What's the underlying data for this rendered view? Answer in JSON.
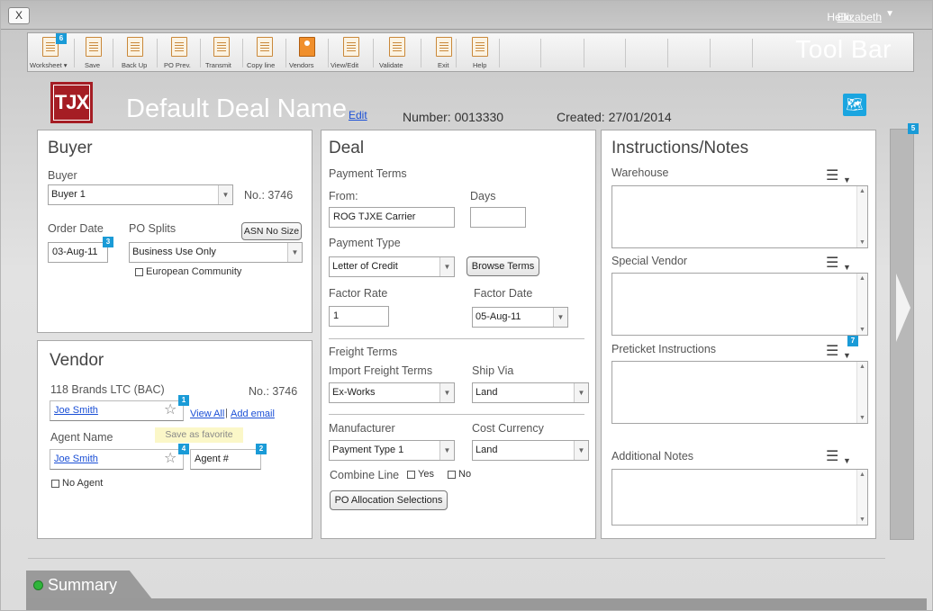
{
  "window": {
    "close_label": "X"
  },
  "user": {
    "greeting": "Hello,",
    "name": "Elizabeth"
  },
  "toolbar": {
    "title": "Tool Bar",
    "items": [
      {
        "label": "Worksheet ▾",
        "badge": "6"
      },
      {
        "label": "Save"
      },
      {
        "label": "Back Up"
      },
      {
        "label": "PO Prev."
      },
      {
        "label": "Transmit"
      },
      {
        "label": "Copy line"
      },
      {
        "label": "Vendors"
      },
      {
        "label": "View/Edit"
      },
      {
        "label": "Validate"
      },
      {
        "label": "Exit"
      },
      {
        "label": "Help"
      }
    ]
  },
  "header": {
    "logo_text": "TJX",
    "deal_name": "Default Deal Name",
    "edit_label": "Edit",
    "number": "Number: 0013330",
    "created": "Created: 27/01/2014"
  },
  "buyer": {
    "title": "Buyer",
    "buyer_label": "Buyer",
    "buyer_value": "Buyer 1",
    "number": "No.: 3746",
    "order_date_label": "Order Date",
    "order_date_value": "03-Aug-11",
    "order_date_badge": "3",
    "po_splits_label": "PO Splits",
    "asn_button": "ASN No Size",
    "po_splits_value": "Business Use Only",
    "european_label": "European Community"
  },
  "vendor": {
    "title": "Vendor",
    "vendor_name": "118 Brands LTC (BAC)",
    "number": "No.: 3746",
    "contact_value": "Joe Smith",
    "contact_badge": "1",
    "view_all": "View All",
    "add_email": "Add email",
    "agent_label": "Agent Name",
    "tooltip": "Save as favorite",
    "agent_value": "Joe Smith",
    "agent_badge": "4",
    "agent_num_placeholder": "Agent #",
    "agent_num_badge": "2",
    "no_agent_label": "No Agent"
  },
  "deal": {
    "title": "Deal",
    "payment_terms_label": "Payment Terms",
    "from_label": "From:",
    "from_value": "ROG TJXE Carrier",
    "days_label": "Days",
    "days_value": "",
    "payment_type_label": "Payment Type",
    "payment_type_value": "Letter of Credit",
    "browse_terms": "Browse Terms",
    "factor_rate_label": "Factor Rate",
    "factor_rate_value": "1",
    "factor_date_label": "Factor Date",
    "factor_date_value": "05-Aug-11",
    "freight_terms_label": "Freight Terms",
    "import_freight_label": "Import Freight Terms",
    "import_freight_value": "Ex-Works",
    "ship_via_label": "Ship Via",
    "ship_via_value": "Land",
    "manufacturer_label": "Manufacturer",
    "manufacturer_value": "Payment Type 1",
    "cost_currency_label": "Cost Currency",
    "cost_currency_value": "Land",
    "combine_line_label": "Combine Line",
    "yes_label": "Yes",
    "no_label": "No",
    "po_allocation": "PO Allocation Selections"
  },
  "notes": {
    "title": "Instructions/Notes",
    "warehouse_label": "Warehouse",
    "special_vendor_label": "Special Vendor",
    "preticket_label": "Preticket Instructions",
    "preticket_badge": "7",
    "additional_label": "Additional Notes"
  },
  "side": {
    "badge": "5"
  },
  "summary": {
    "label": "Summary"
  },
  "colors": {
    "accent_badge": "#1a9bd7",
    "brand": "#a51d24",
    "link": "#1a4fd6",
    "status_dot": "#2fb53a"
  }
}
